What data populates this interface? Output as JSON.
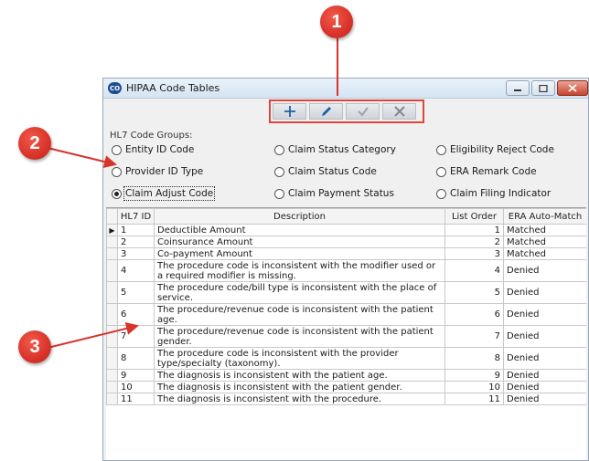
{
  "window": {
    "title": "HIPAA Code Tables",
    "app_icon_text": "CO"
  },
  "callouts": [
    "1",
    "2",
    "3"
  ],
  "toolbar": {
    "buttons": [
      {
        "name": "add",
        "icon": "plus-icon",
        "enabled": true
      },
      {
        "name": "edit",
        "icon": "pencil-icon",
        "enabled": true
      },
      {
        "name": "save",
        "icon": "checkmark-icon",
        "enabled": false
      },
      {
        "name": "cancel",
        "icon": "x-icon",
        "enabled": false
      }
    ]
  },
  "code_groups": {
    "label": "HL7 Code Groups:",
    "options": [
      {
        "label": "Entity ID Code",
        "selected": false
      },
      {
        "label": "Claim Status Category",
        "selected": false
      },
      {
        "label": "Eligibility Reject Code",
        "selected": false
      },
      {
        "label": "Provider ID Type",
        "selected": false
      },
      {
        "label": "Claim Status Code",
        "selected": false
      },
      {
        "label": "ERA Remark Code",
        "selected": false
      },
      {
        "label": "Claim Adjust Code",
        "selected": true
      },
      {
        "label": "Claim Payment Status",
        "selected": false
      },
      {
        "label": "Claim Filing Indicator",
        "selected": false
      }
    ]
  },
  "table": {
    "columns": [
      "HL7 ID",
      "Description",
      "List Order",
      "ERA Auto-Match"
    ],
    "rows": [
      {
        "id": "1",
        "description": "Deductible Amount",
        "order": "1",
        "era": "Matched"
      },
      {
        "id": "2",
        "description": "Coinsurance Amount",
        "order": "2",
        "era": "Matched"
      },
      {
        "id": "3",
        "description": "Co-payment Amount",
        "order": "3",
        "era": "Matched"
      },
      {
        "id": "4",
        "description": "The procedure code is inconsistent with the modifier used or a required modifier is missing.",
        "order": "4",
        "era": "Denied"
      },
      {
        "id": "5",
        "description": "The procedure code/bill type is inconsistent with the place of service.",
        "order": "5",
        "era": "Denied"
      },
      {
        "id": "6",
        "description": "The procedure/revenue code is inconsistent with the patient age.",
        "order": "6",
        "era": "Denied"
      },
      {
        "id": "7",
        "description": "The procedure/revenue code is inconsistent with the patient gender.",
        "order": "7",
        "era": "Denied"
      },
      {
        "id": "8",
        "description": "The procedure code is inconsistent with the provider type/specialty (taxonomy).",
        "order": "8",
        "era": "Denied"
      },
      {
        "id": "9",
        "description": "The diagnosis is inconsistent with the patient age.",
        "order": "9",
        "era": "Denied"
      },
      {
        "id": "10",
        "description": "The diagnosis is inconsistent with the patient gender.",
        "order": "10",
        "era": "Denied"
      },
      {
        "id": "11",
        "description": "The diagnosis is inconsistent with the procedure.",
        "order": "11",
        "era": "Denied"
      }
    ]
  },
  "colors": {
    "callout": "#d9332a",
    "highlight_border": "#e0463b",
    "toolbar_icon_active": "#1f5fa8",
    "toolbar_icon_disabled": "#9aa3ab"
  }
}
